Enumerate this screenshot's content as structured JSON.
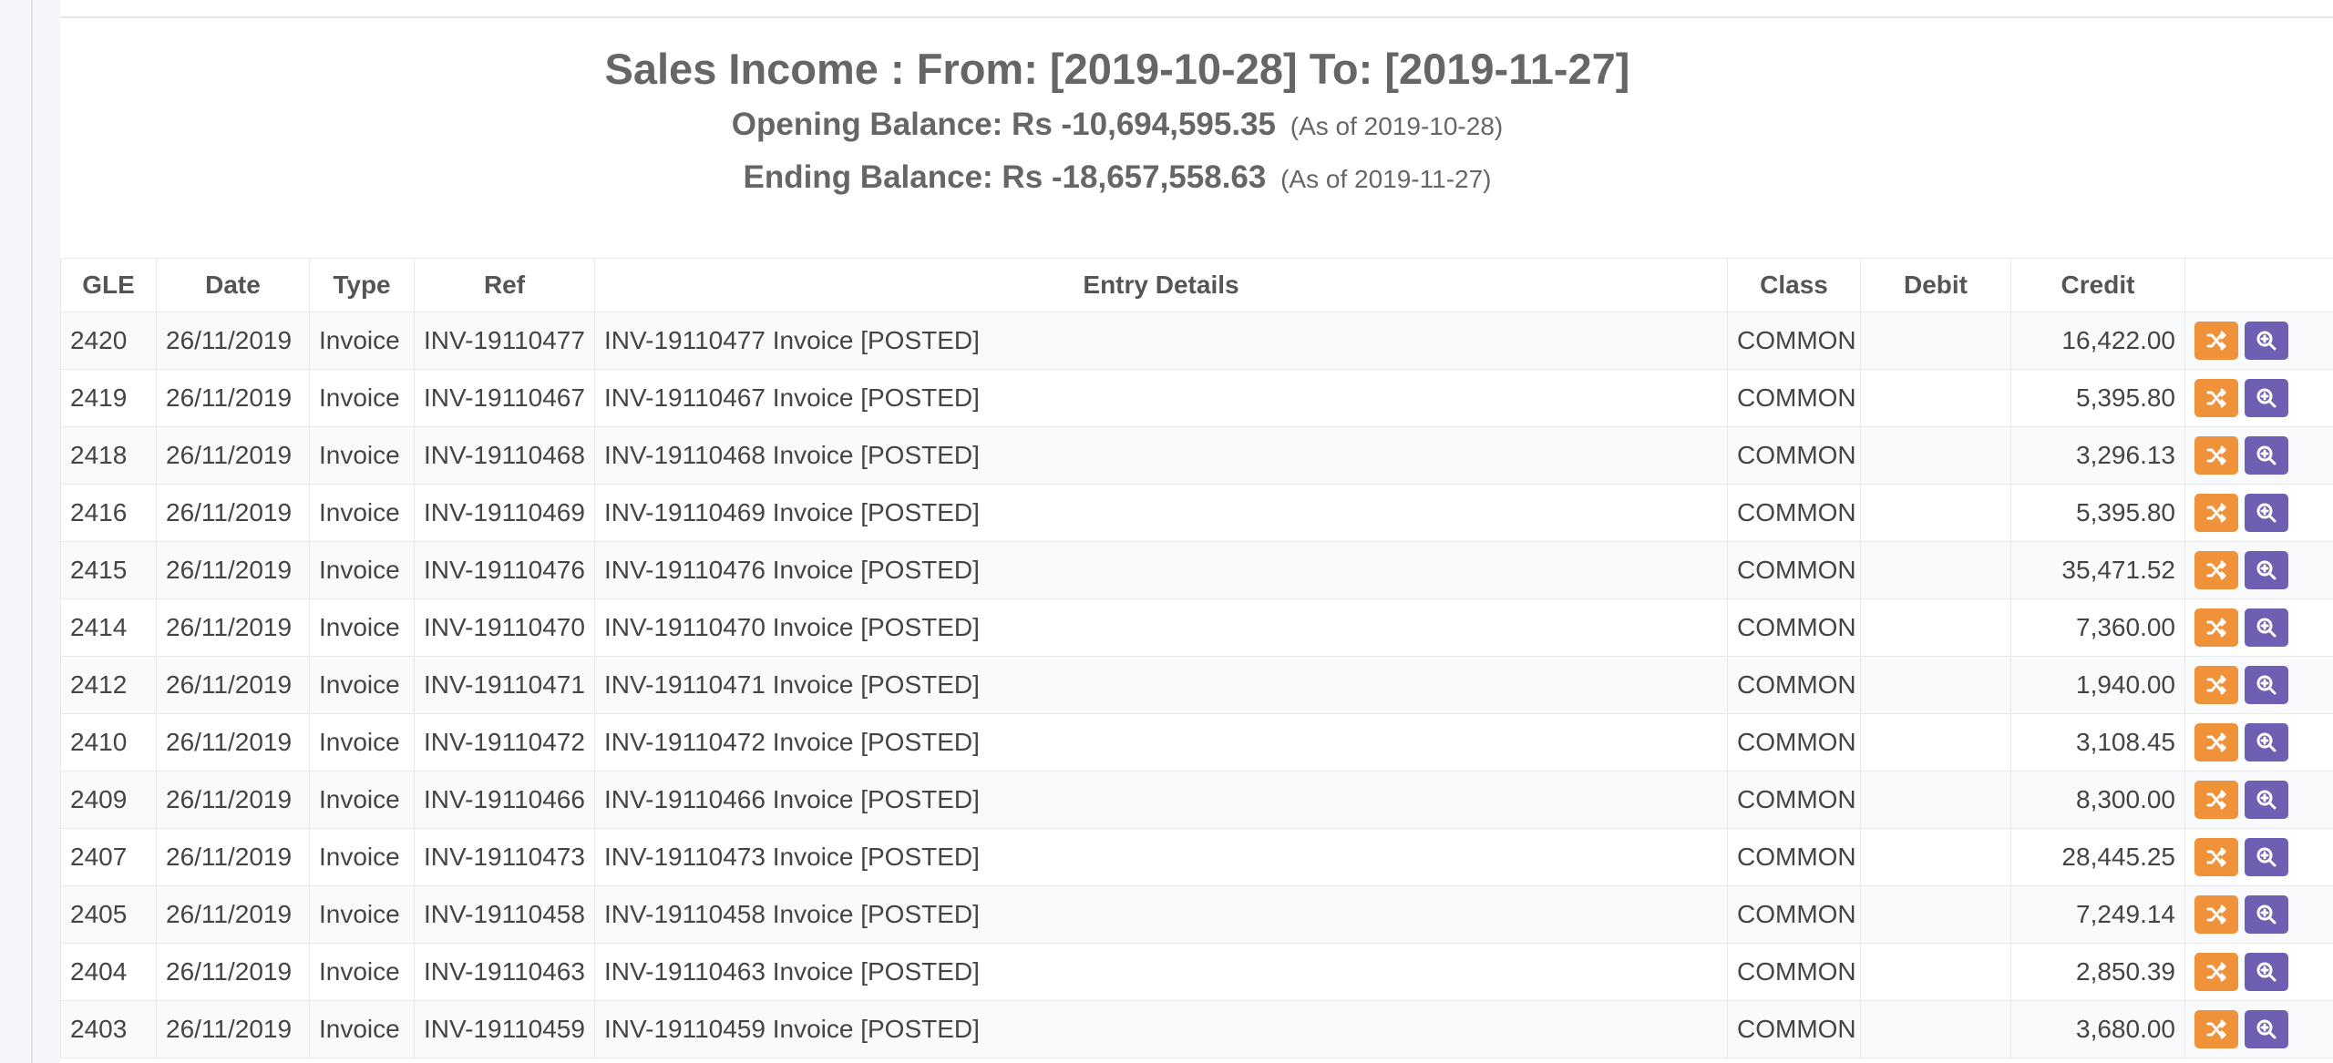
{
  "report": {
    "title": "Sales Income : From: [2019-10-28] To: [2019-11-27]",
    "opening_label": "Opening Balance: Rs -10,694,595.35",
    "opening_asof": "(As of 2019-10-28)",
    "ending_label": "Ending Balance: Rs -18,657,558.63",
    "ending_asof": "(As of 2019-11-27)"
  },
  "table": {
    "headers": {
      "gle": "GLE",
      "date": "Date",
      "type": "Type",
      "ref": "Ref",
      "details": "Entry Details",
      "class": "Class",
      "debit": "Debit",
      "credit": "Credit"
    },
    "rows": [
      {
        "gle": "2420",
        "date": "26/11/2019",
        "type": "Invoice",
        "ref": "INV-19110477",
        "details": "INV-19110477 Invoice [POSTED]",
        "class": "COMMON",
        "debit": "",
        "credit": "16,422.00"
      },
      {
        "gle": "2419",
        "date": "26/11/2019",
        "type": "Invoice",
        "ref": "INV-19110467",
        "details": "INV-19110467 Invoice [POSTED]",
        "class": "COMMON",
        "debit": "",
        "credit": "5,395.80"
      },
      {
        "gle": "2418",
        "date": "26/11/2019",
        "type": "Invoice",
        "ref": "INV-19110468",
        "details": "INV-19110468 Invoice [POSTED]",
        "class": "COMMON",
        "debit": "",
        "credit": "3,296.13"
      },
      {
        "gle": "2416",
        "date": "26/11/2019",
        "type": "Invoice",
        "ref": "INV-19110469",
        "details": "INV-19110469 Invoice [POSTED]",
        "class": "COMMON",
        "debit": "",
        "credit": "5,395.80"
      },
      {
        "gle": "2415",
        "date": "26/11/2019",
        "type": "Invoice",
        "ref": "INV-19110476",
        "details": "INV-19110476 Invoice [POSTED]",
        "class": "COMMON",
        "debit": "",
        "credit": "35,471.52"
      },
      {
        "gle": "2414",
        "date": "26/11/2019",
        "type": "Invoice",
        "ref": "INV-19110470",
        "details": "INV-19110470 Invoice [POSTED]",
        "class": "COMMON",
        "debit": "",
        "credit": "7,360.00"
      },
      {
        "gle": "2412",
        "date": "26/11/2019",
        "type": "Invoice",
        "ref": "INV-19110471",
        "details": "INV-19110471 Invoice [POSTED]",
        "class": "COMMON",
        "debit": "",
        "credit": "1,940.00"
      },
      {
        "gle": "2410",
        "date": "26/11/2019",
        "type": "Invoice",
        "ref": "INV-19110472",
        "details": "INV-19110472 Invoice [POSTED]",
        "class": "COMMON",
        "debit": "",
        "credit": "3,108.45"
      },
      {
        "gle": "2409",
        "date": "26/11/2019",
        "type": "Invoice",
        "ref": "INV-19110466",
        "details": "INV-19110466 Invoice [POSTED]",
        "class": "COMMON",
        "debit": "",
        "credit": "8,300.00"
      },
      {
        "gle": "2407",
        "date": "26/11/2019",
        "type": "Invoice",
        "ref": "INV-19110473",
        "details": "INV-19110473 Invoice [POSTED]",
        "class": "COMMON",
        "debit": "",
        "credit": "28,445.25"
      },
      {
        "gle": "2405",
        "date": "26/11/2019",
        "type": "Invoice",
        "ref": "INV-19110458",
        "details": "INV-19110458 Invoice [POSTED]",
        "class": "COMMON",
        "debit": "",
        "credit": "7,249.14"
      },
      {
        "gle": "2404",
        "date": "26/11/2019",
        "type": "Invoice",
        "ref": "INV-19110463",
        "details": "INV-19110463 Invoice [POSTED]",
        "class": "COMMON",
        "debit": "",
        "credit": "2,850.39"
      },
      {
        "gle": "2403",
        "date": "26/11/2019",
        "type": "Invoice",
        "ref": "INV-19110459",
        "details": "INV-19110459 Invoice [POSTED]",
        "class": "COMMON",
        "debit": "",
        "credit": "3,680.00"
      }
    ]
  },
  "actions": {
    "shuffle_icon": "shuffle-icon",
    "zoom_icon": "zoom-in-icon",
    "shuffle_color": "#f0923a",
    "zoom_color": "#6f5fb3"
  }
}
